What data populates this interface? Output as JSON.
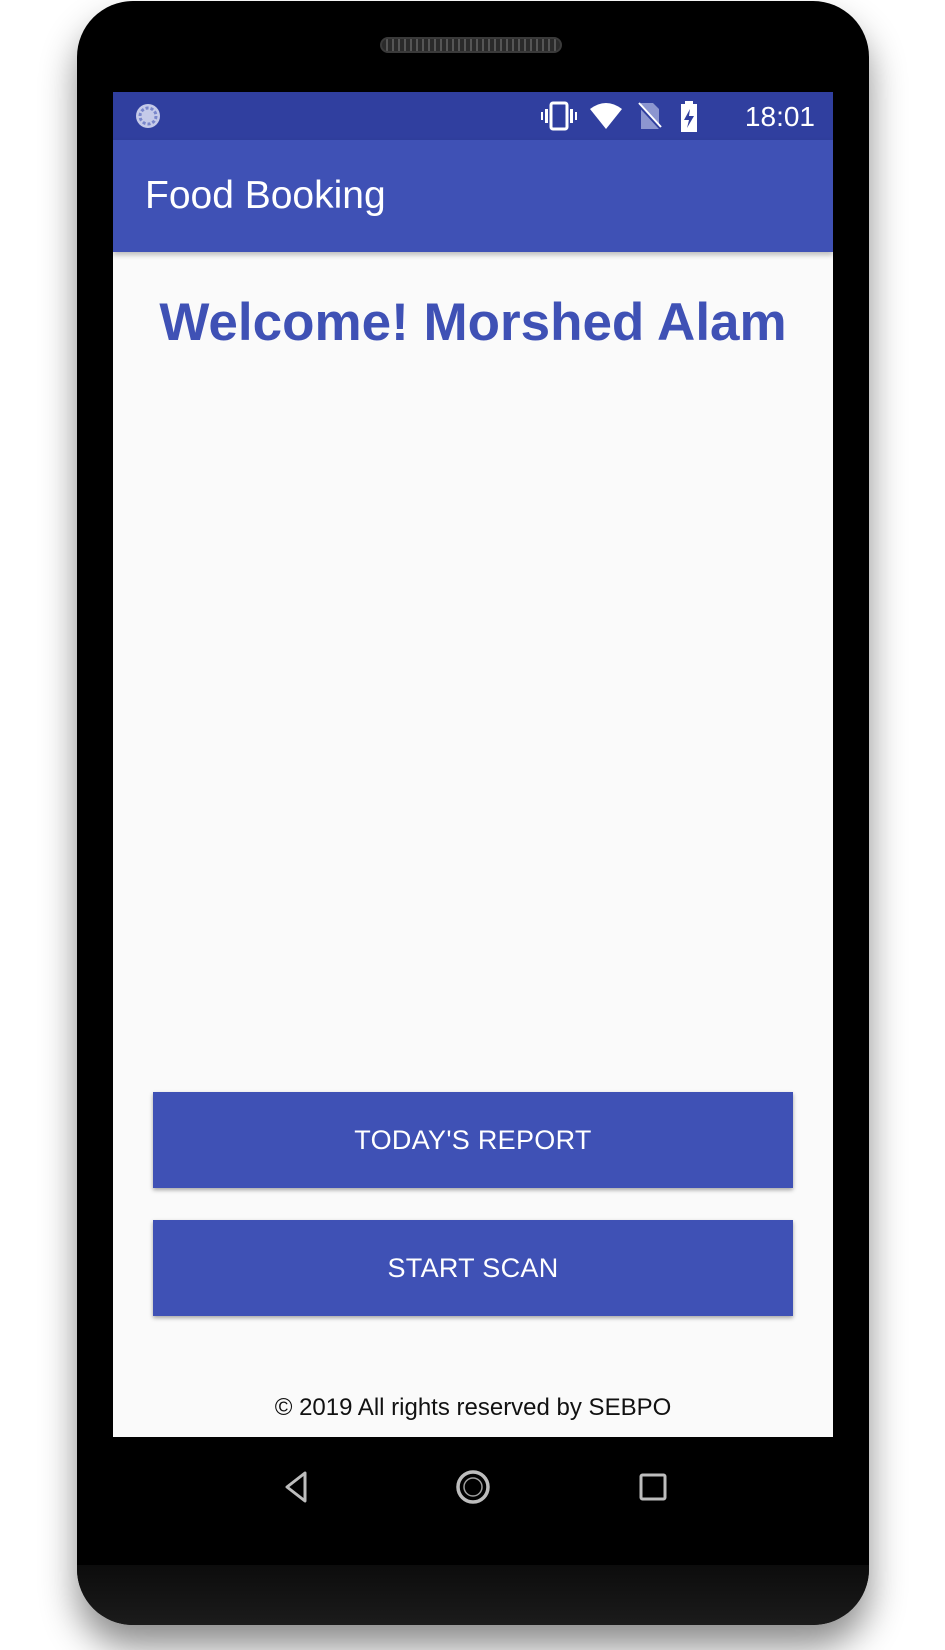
{
  "status_bar": {
    "time": "18:01",
    "icons": [
      "loading-icon",
      "vibrate-icon",
      "wifi-icon",
      "no-sim-icon",
      "battery-charging-icon"
    ]
  },
  "app_bar": {
    "title": "Food Booking"
  },
  "main": {
    "welcome_text": "Welcome! Morshed Alam",
    "report_button_label": "TODAY'S REPORT",
    "scan_button_label": "START SCAN"
  },
  "footer": {
    "text": "© 2019 All rights reserved by SEBPO"
  },
  "nav_bar": {
    "icons": [
      "back-icon",
      "home-icon",
      "recents-icon"
    ]
  },
  "colors": {
    "primary": "#3f51b5",
    "primary_dark": "#303f9f",
    "background": "#fafafa",
    "phone_body": "#000000"
  }
}
